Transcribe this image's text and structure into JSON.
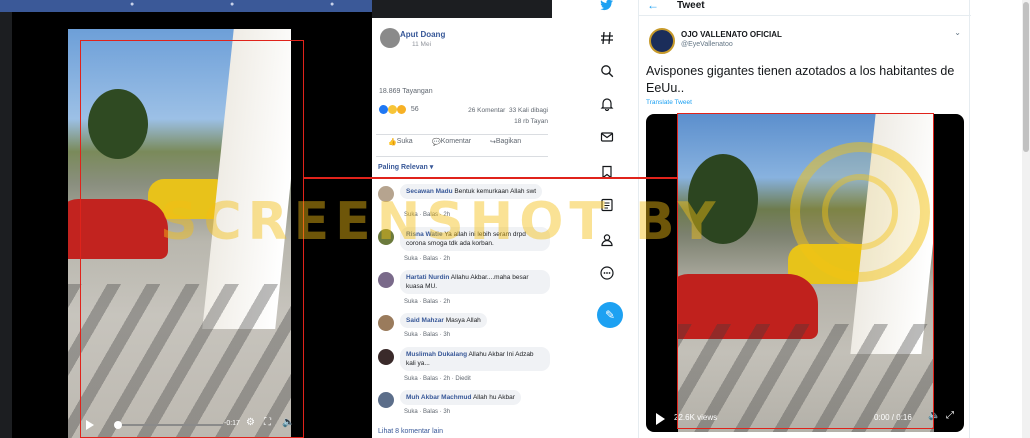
{
  "facebook": {
    "author": "Aput Doang",
    "date": "11 Mei",
    "views": "18.869 Tayangan",
    "reaction_count": "56",
    "comments_count": "26 Komentar",
    "shares": "33 Kali dibagi",
    "plays": "18 rb Tayan",
    "actions": {
      "like": "Suka",
      "comment": "Komentar",
      "share": "Bagikan"
    },
    "sort_label": "Paling Relevan",
    "video_time": "-0:17",
    "comments": [
      {
        "name": "Secawan Madu",
        "text": "Bentuk kemurkaan Allah swt",
        "like": "Suka",
        "reply": "Balas",
        "age": "2h"
      },
      {
        "name": "Risna Watie",
        "text": "Ya allah ini lebih seram drpd corona smoga tdk ada korban.",
        "like": "Suka",
        "reply": "Balas",
        "age": "2h"
      },
      {
        "name": "Hartati Nurdin",
        "text": "Allahu Akbar....maha besar kuasa MU.",
        "like": "Suka",
        "reply": "Balas",
        "age": "2h"
      },
      {
        "name": "Said Mahzar",
        "text": "Masya Allah",
        "like": "Suka",
        "reply": "Balas",
        "age": "3h"
      },
      {
        "name": "Muslimah Dukalang",
        "text": "Allahu Akbar Ini Adzab kali ya...",
        "like": "Suka",
        "reply": "Balas",
        "age": "2h",
        "edited": "Diedit"
      },
      {
        "name": "Muh Akbar Machmud",
        "text": "Allah hu Akbar",
        "like": "Suka",
        "reply": "Balas",
        "age": "3h"
      }
    ],
    "more_comments": "Lihat 8 komentar lain"
  },
  "twitter": {
    "header": "Tweet",
    "display_name": "OJO VALLENATO OFICIAL",
    "handle": "@EyeVallenatoo",
    "tweet_text": "Avispones gigantes tienen azotados a los habitantes de EeUu..",
    "translate": "Translate Tweet",
    "views": "22.6K views",
    "time": "0:00 / 0:16",
    "nav_icons": [
      "twitter-bird-icon",
      "explore-hash-icon",
      "search-icon",
      "notifications-bell-icon",
      "messages-mail-icon",
      "bookmark-icon",
      "lists-icon",
      "profile-icon",
      "more-icon"
    ]
  },
  "colors": {
    "facebook_blue": "#385898",
    "twitter_blue": "#1da1f2",
    "annotation_red": "#e0231b"
  }
}
